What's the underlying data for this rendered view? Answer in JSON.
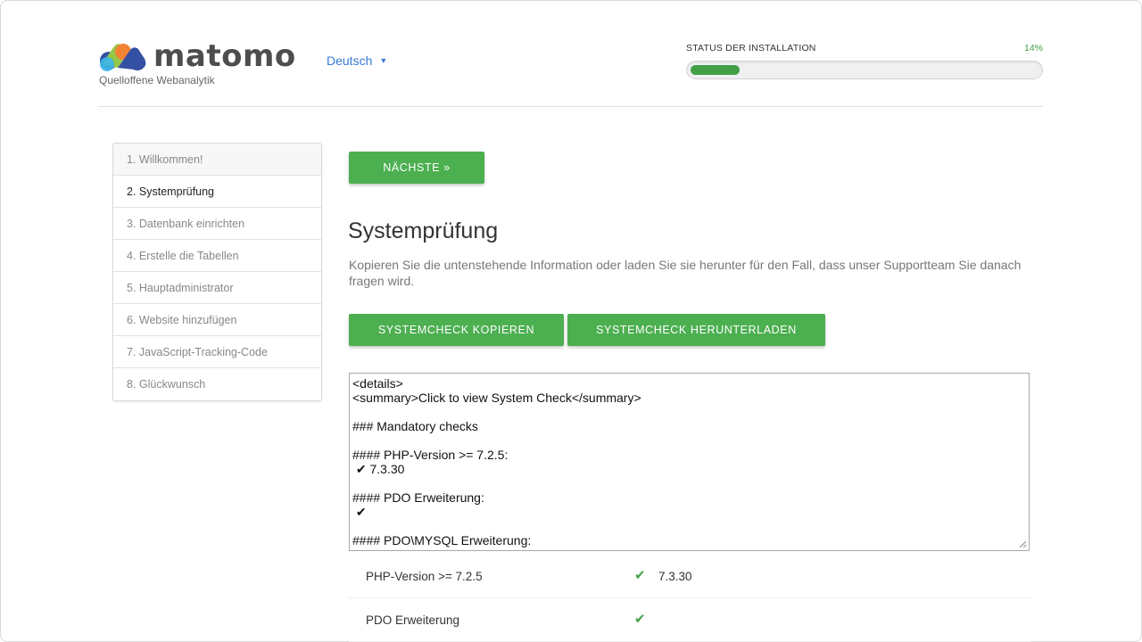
{
  "header": {
    "brand": "matomo",
    "tagline": "Quelloffene Webanalytik",
    "language": "Deutsch",
    "status_label": "STATUS DER INSTALLATION",
    "status_percent": "14%",
    "progress_fraction": 0.14,
    "accent_color": "#43a047",
    "link_color": "#3a7bd5"
  },
  "steps": [
    {
      "label": "1. Willkommen!"
    },
    {
      "label": "2. Systemprüfung"
    },
    {
      "label": "3. Datenbank einrichten"
    },
    {
      "label": "4. Erstelle die Tabellen"
    },
    {
      "label": "5. Hauptadministrator"
    },
    {
      "label": "6. Website hinzufügen"
    },
    {
      "label": "7. JavaScript-Tracking-Code"
    },
    {
      "label": "8. Glückwunsch"
    }
  ],
  "main": {
    "next_button": "NÄCHSTE »",
    "title": "Systemprüfung",
    "description": "Kopieren Sie die untenstehende Information oder laden Sie sie herunter für den Fall, dass unser Supportteam Sie danach fragen wird.",
    "copy_button": "SYSTEMCHECK KOPIEREN",
    "download_button": "SYSTEMCHECK HERUNTERLADEN",
    "system_check_lines": [
      "<details>",
      "<summary>Click to view System Check</summary>",
      "",
      "### Mandatory checks",
      "",
      "#### PHP-Version >= 7.2.5:",
      " ✔ 7.3.30",
      "",
      "#### PDO Erweiterung:",
      " ✔",
      "",
      "#### PDO\\MYSQL Erweiterung:",
      " ✔"
    ],
    "checks": [
      {
        "name": "PHP-Version >= 7.2.5",
        "icon": "check-icon",
        "value": "7.3.30"
      },
      {
        "name": "PDO Erweiterung",
        "icon": "check-icon",
        "value": ""
      }
    ]
  }
}
